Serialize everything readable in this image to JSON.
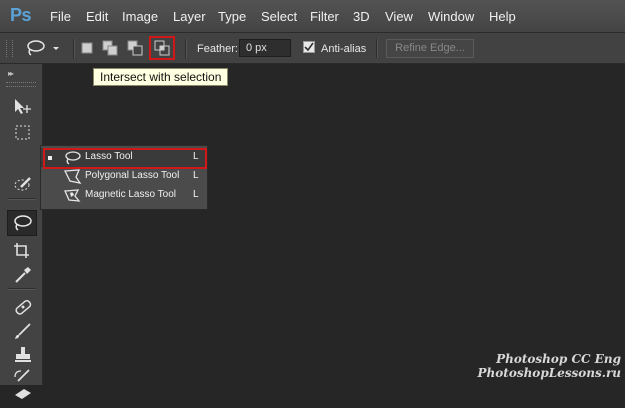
{
  "app": {
    "logo": "Ps"
  },
  "menu": [
    "File",
    "Edit",
    "Image",
    "Layer",
    "Type",
    "Select",
    "Filter",
    "3D",
    "View",
    "Window",
    "Help"
  ],
  "options": {
    "feather_label": "Feather:",
    "feather_value": "0 px",
    "antialias_label": "Anti-alias",
    "antialias_checked": true,
    "refine_edge_label": "Refine Edge...",
    "selection_modes": [
      "new-selection-icon",
      "add-to-selection-icon",
      "subtract-from-selection-icon",
      "intersect-with-selection-icon"
    ],
    "highlight_color": "#d01818"
  },
  "tooltip": {
    "text": "Intersect with selection"
  },
  "flyout": {
    "items": [
      {
        "label": "Lasso Tool",
        "shortcut": "L",
        "icon": "lasso-icon",
        "selected": true
      },
      {
        "label": "Polygonal Lasso Tool",
        "shortcut": "L",
        "icon": "polygonal-lasso-icon",
        "selected": false
      },
      {
        "label": "Magnetic Lasso Tool",
        "shortcut": "L",
        "icon": "magnetic-lasso-icon",
        "selected": false
      }
    ]
  },
  "toolbar": {
    "tools": [
      "move-tool-icon",
      "marquee-tool-icon",
      "lasso-tool-icon",
      "quick-selection-tool-icon",
      "crop-tool-icon",
      "eyedropper-tool-icon",
      "healing-brush-tool-icon",
      "brush-tool-icon",
      "clone-stamp-tool-icon",
      "history-brush-tool-icon",
      "eraser-tool-icon"
    ]
  },
  "watermark": {
    "line1": "Photoshop  CC  Eng",
    "line2": "PhotoshopLessons.ru"
  }
}
